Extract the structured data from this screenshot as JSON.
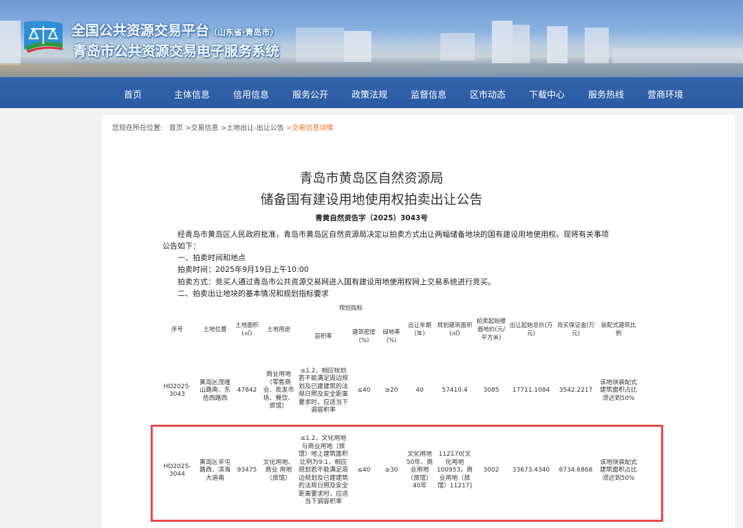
{
  "header": {
    "title_main": "全国公共资源交易平台",
    "title_region": "（山东省·青岛市）",
    "title_sub": "青岛市公共资源交易电子服务系统"
  },
  "nav": [
    "首页",
    "主体信息",
    "信用信息",
    "服务公开",
    "政策法规",
    "监督信息",
    "区市动态",
    "下载中心",
    "服务热线",
    "营商环境"
  ],
  "breadcrumb": {
    "label": "您现在所在位置:",
    "items": [
      "首页",
      ">交易信息",
      ">土地出让-出让公告"
    ],
    "current": ">交易信息详情"
  },
  "doc": {
    "title1": "青岛市黄岛区自然资源局",
    "title2": "储备国有建设用地使用权拍卖出让公告",
    "number": "青黄自然资告字（2025）3043号",
    "intro1": "经青岛市黄岛区人民政府批准，青岛市黄岛区自然资源局决定以拍卖方式出让两幅储备地块的国有建设用地使用权。现将有关事项",
    "intro2": "公告如下：",
    "s1": "一、拍卖时间和地点",
    "time": "拍卖时间：2025年9月19日上午10:00",
    "method": "拍卖方式：竞买人通过青岛市公共资源交易网进入国有建设用地使用权网上交易系统进行竞买。",
    "s2": "二、拍卖出让地块的基本情况和规划指标要求"
  },
  "table": {
    "group_header": "规划指标",
    "headers": [
      "序号",
      "土地位置",
      "土地面积(㎡)",
      "土地用途",
      "容积率",
      "建筑密度(%)",
      "绿地率(%)",
      "出让年期(年)",
      "规划建筑面积(㎡)",
      "拍卖起始楼面地价(元/平方米)",
      "出让起始总价(万元)",
      "竞买保证金(万元)",
      "装配式建筑比例"
    ],
    "rows": [
      [
        "HD2025-3043",
        "黄岛区茂隆山路南、东岳西路西",
        "47842",
        "商业用地（零售商业、批发市场、餐饮、旅馆）",
        "≤1.2，相应规划若不能满足周边规划及已建建筑的法规日照及安全距离要求时，应适当下调容积率",
        "≤40",
        "≥20",
        "40",
        "57410.4",
        "3085",
        "17711.1084",
        "3542.2217",
        "该地块装配式建筑面积占比须达到50%"
      ],
      [
        "HD2025-3044",
        "黄岛区辛屯路西、滨海大道南",
        "93475",
        "文化用地、商业 用地（旅馆）",
        "≤1.2，文化用地与商业用地（旅馆）地上建筑面积比例为9:1，相应规划若不能满足周边规划及已建建筑的法规日照及安全距离要求时，应适当下调容积率",
        "≤40",
        "≥30",
        "文化用地50年、商业用地（旅馆）40年",
        "112170[文化用地100953，商业用地（旅馆）11217]",
        "3002",
        "33673.4340",
        "6734.6868",
        "该地块装配式建筑面积占比须达到50%"
      ]
    ]
  },
  "colors": {
    "accent": "#f26b1d",
    "highlight": "#e8484a"
  }
}
